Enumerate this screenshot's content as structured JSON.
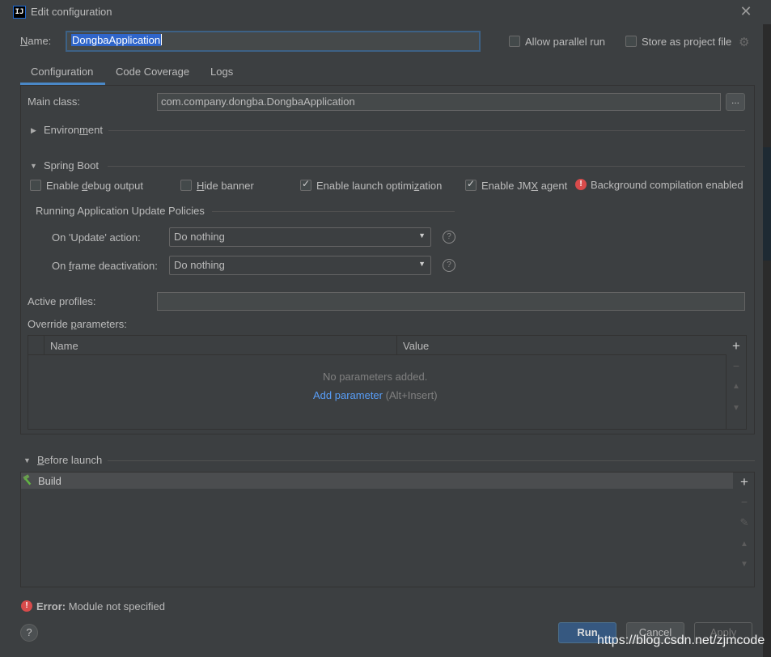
{
  "window": {
    "title": "Edit configuration",
    "app_icon_text": "IJ"
  },
  "header": {
    "name_label": "Name:",
    "name_value": "DongbaApplication",
    "allow_parallel_run": "Allow parallel run",
    "store_as_project_file": "Store as project file"
  },
  "tabs": [
    {
      "label": "Configuration",
      "active": true
    },
    {
      "label": "Code Coverage",
      "active": false
    },
    {
      "label": "Logs",
      "active": false
    }
  ],
  "config": {
    "main_class_label": "Main class:",
    "main_class_value": "com.company.dongba.DongbaApplication",
    "browse_label": "...",
    "environment_label": "Environment",
    "spring_boot_label": "Spring Boot",
    "options": [
      {
        "label": "Enable debug output",
        "checked": false
      },
      {
        "label": "Hide banner",
        "checked": false
      },
      {
        "label": "Enable launch optimization",
        "checked": true
      },
      {
        "label": "Enable JMX agent",
        "checked": true
      }
    ],
    "bg_compilation": "Background compilation enabled",
    "policies_label": "Running Application Update Policies",
    "update_action_label": "On 'Update' action:",
    "update_action_value": "Do nothing",
    "frame_deactivation_label": "On frame deactivation:",
    "frame_deactivation_value": "Do nothing",
    "active_profiles_label": "Active profiles:",
    "active_profiles_value": "",
    "override_label": "Override parameters:",
    "table_headers": [
      "Name",
      "Value"
    ],
    "empty_text": "No parameters added.",
    "add_parameter": "Add parameter",
    "add_shortcut": "(Alt+Insert)"
  },
  "before_launch": {
    "label": "Before launch",
    "items": [
      "Build"
    ]
  },
  "error": {
    "prefix": "Error:",
    "message": "Module not specified"
  },
  "buttons": {
    "run": "Run",
    "cancel": "Cancel",
    "apply": "Apply",
    "help": "?"
  },
  "watermark": "https://blog.csdn.net/zjmcode",
  "colors": {
    "background": "#3c3f41",
    "accent": "#4a88c7",
    "link": "#589df6",
    "error": "#d84b4b",
    "run_button": "#365880"
  }
}
